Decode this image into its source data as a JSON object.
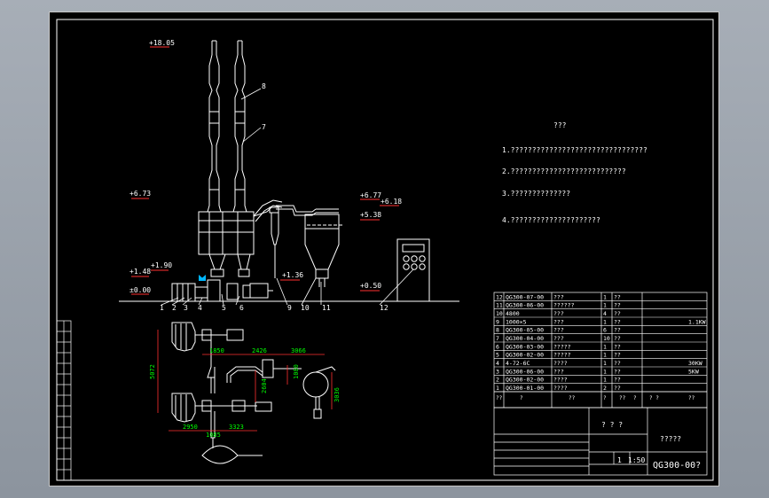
{
  "title_block": {
    "drawing_no": "QG300-00?",
    "name": "?????",
    "company": "? ? ?",
    "scale": "1:50",
    "sheet": "1"
  },
  "notes": {
    "heading": "???",
    "items": [
      "1.????????????????????????????????",
      "2.???????????????????????????",
      "3.??????????????",
      "4.?????????????????????"
    ]
  },
  "elevations": {
    "top": "+18.05",
    "e673": "+6.73",
    "e677": "+6.77",
    "e618": "+6.18",
    "e538": "+5.38",
    "e190": "+1.90",
    "e148": "+1.48",
    "e136": "+1.36",
    "e050": "+0.50",
    "e000": "±0.00"
  },
  "balloons": [
    "1",
    "2",
    "3",
    "4",
    "5",
    "6",
    "7",
    "8",
    "9",
    "10",
    "11",
    "12"
  ],
  "plan_dimensions": {
    "d5072": "5072",
    "d1850": "1850",
    "d2426": "2426",
    "d3066": "3066",
    "d2604": "2604",
    "d1080": "1080",
    "d2950": "2950",
    "d3323": "3323",
    "d1085": "1085",
    "d3036": "3036"
  },
  "parts_list": [
    {
      "no": "12",
      "code": "QG300-07-00",
      "name": "???",
      "qty": "1",
      "mat": "??",
      "note": ""
    },
    {
      "no": "11",
      "code": "QG300-06-00",
      "name": "??????",
      "qty": "1",
      "mat": "??",
      "note": ""
    },
    {
      "no": "10",
      "code": "4800",
      "name": "???",
      "qty": "4",
      "mat": "??",
      "note": ""
    },
    {
      "no": "9",
      "code": "1000×5",
      "name": "???",
      "qty": "1",
      "mat": "??",
      "note": "1.1KW"
    },
    {
      "no": "8",
      "code": "QG300-05-00",
      "name": "???",
      "qty": "6",
      "mat": "??",
      "note": ""
    },
    {
      "no": "7",
      "code": "QG300-04-00",
      "name": "???",
      "qty": "10",
      "mat": "??",
      "note": ""
    },
    {
      "no": "6",
      "code": "QG300-03-00",
      "name": "?????",
      "qty": "1",
      "mat": "??",
      "note": ""
    },
    {
      "no": "5",
      "code": "QG300-02-00",
      "name": "?????",
      "qty": "1",
      "mat": "??",
      "note": ""
    },
    {
      "no": "4",
      "code": "4-72-6C",
      "name": "????",
      "qty": "1",
      "mat": "??",
      "note": "30KW"
    },
    {
      "no": "3",
      "code": "QG300-06-00",
      "name": "???",
      "qty": "1",
      "mat": "??",
      "note": "5KW"
    },
    {
      "no": "2",
      "code": "QG300-02-00",
      "name": "????",
      "qty": "1",
      "mat": "??",
      "note": ""
    },
    {
      "no": "1",
      "code": "QG300-01-00",
      "name": "????",
      "qty": "2",
      "mat": "??",
      "note": ""
    }
  ],
  "parts_header": [
    "??",
    "?",
    "??",
    "?",
    "??",
    "?",
    "? ?",
    "??"
  ]
}
